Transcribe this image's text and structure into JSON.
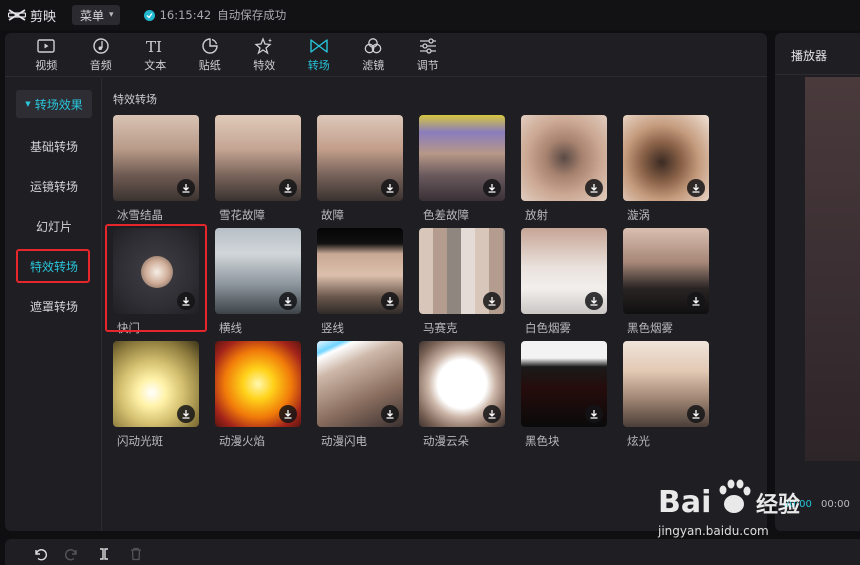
{
  "app": {
    "name": "剪映",
    "menu_label": "菜单",
    "save_time": "16:15:42",
    "save_text": "自动保存成功"
  },
  "toolbar": {
    "tabs": [
      {
        "label": "视频",
        "icon": "video-icon"
      },
      {
        "label": "音频",
        "icon": "audio-icon"
      },
      {
        "label": "文本",
        "icon": "text-icon"
      },
      {
        "label": "贴纸",
        "icon": "sticker-icon"
      },
      {
        "label": "特效",
        "icon": "effects-icon"
      },
      {
        "label": "转场",
        "icon": "transition-icon",
        "active": true
      },
      {
        "label": "滤镜",
        "icon": "filter-icon"
      },
      {
        "label": "调节",
        "icon": "adjust-icon"
      }
    ]
  },
  "sidebar": {
    "header": "转场效果",
    "items": [
      "基础转场",
      "运镜转场",
      "幻灯片",
      "特效转场",
      "遮罩转场"
    ],
    "active_item": "特效转场"
  },
  "content": {
    "section_title": "特效转场",
    "items": [
      "冰雪结晶",
      "雪花故障",
      "故障",
      "色差故障",
      "放射",
      "漩涡",
      "快门",
      "横线",
      "竖线",
      "马赛克",
      "白色烟雾",
      "黑色烟雾",
      "闪动光斑",
      "动漫火焰",
      "动漫闪电",
      "动漫云朵",
      "黑色块",
      "炫光"
    ]
  },
  "player": {
    "title": "播放器",
    "current_time": "00:00",
    "total_time": "00:00"
  },
  "watermark": {
    "logo_text": "Bai du 经验",
    "url": "jingyan.baidu.com"
  },
  "colors": {
    "accent": "#26c4d8",
    "highlight_box": "#e5262b",
    "panel_bg": "#1e1e23"
  }
}
